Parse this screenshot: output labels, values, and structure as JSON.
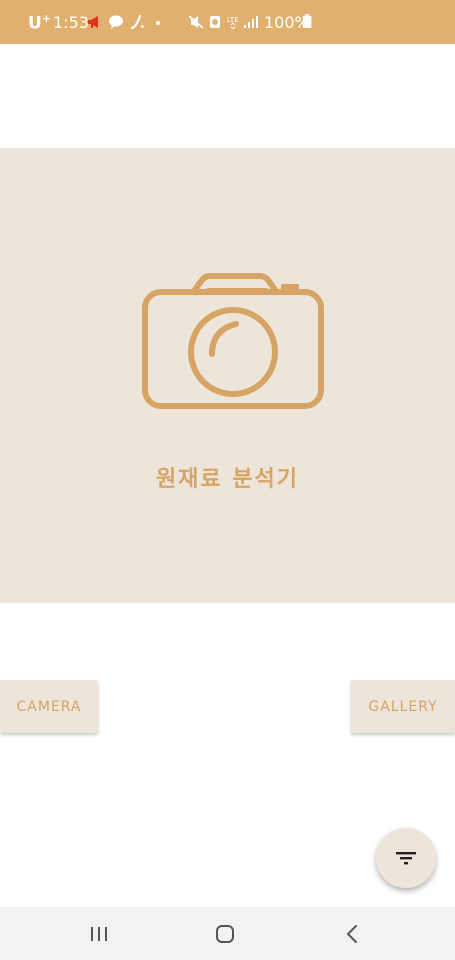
{
  "status_bar": {
    "carrier": "U",
    "carrier_sup": "+",
    "time": "1:53",
    "battery": "100%",
    "network": "LTE",
    "icons": [
      "megaphone-icon",
      "chat-bubble-icon",
      "missed-call-icon",
      "dot-icon",
      "mute-icon",
      "alarm-icon",
      "lte-icon",
      "signal-icon",
      "battery-icon"
    ],
    "background": "#E2B06E"
  },
  "hero": {
    "icon": "camera-icon",
    "title": "원재료 분석기",
    "background": "#EDE5D9",
    "accent": "#D6A464"
  },
  "buttons": {
    "camera_label": "CAMERA",
    "gallery_label": "GALLERY"
  },
  "fab": {
    "icon": "filter-icon"
  },
  "nav_bar": {
    "icons": [
      "recent-apps-icon",
      "home-icon",
      "back-icon"
    ]
  }
}
